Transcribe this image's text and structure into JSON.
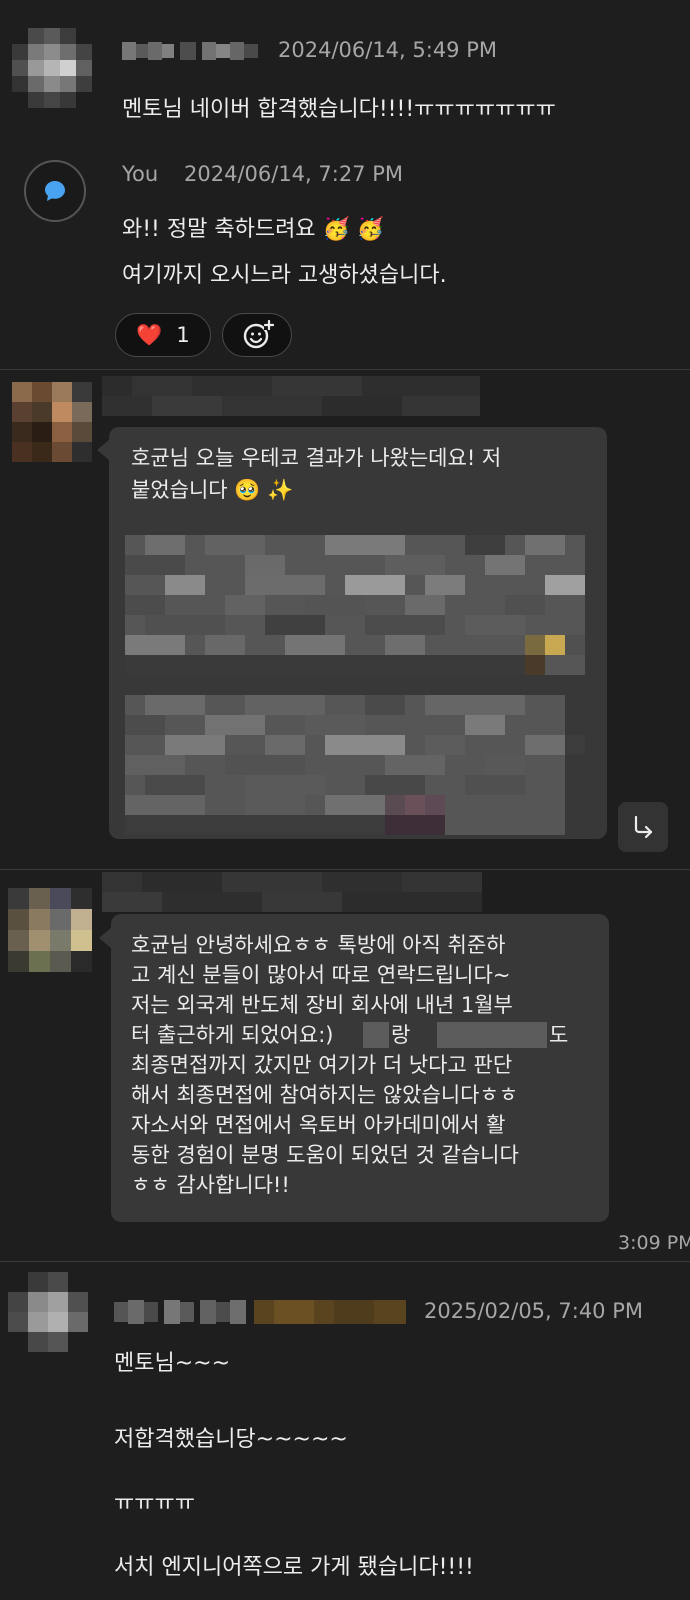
{
  "messages": [
    {
      "timestamp": "2024/06/14, 5:49 PM",
      "text": "멘토님 네이버 합격했습니다!!!!ㅠㅠㅠㅠㅠㅠㅠ"
    },
    {
      "sender": "You",
      "timestamp": "2024/06/14, 7:27 PM",
      "lines": [
        "와!! 정말 축하드려요 🥳 🥳",
        "여기까지 오시느라 고생하셨습니다."
      ],
      "reaction": {
        "emoji": "❤️",
        "count": "1"
      }
    },
    {
      "lines": [
        "호균님 오늘 우테코 결과가 나왔는데요! 저",
        "붙었습니다 🥹 ✨"
      ]
    },
    {
      "lines": [
        "호균님 안녕하세요ㅎㅎ 톡방에 아직 취준하",
        "고 계신 분들이 많아서 따로 연락드립니다~",
        "저는 외국계 반도체 장비 회사에 내년 1월부",
        "터 출근하게 되었어요:)",
        "랑",
        "도",
        "최종면접까지 갔지만 여기가 더 낫다고 판단",
        "해서 최종면접에 참여하지는 않았습니다ㅎㅎ",
        "자소서와 면접에서 옥토버 아카데미에서 활",
        "동한 경험이 분명 도움이 되었던 것 같습니다",
        "ㅎㅎ 감사합니다!!"
      ],
      "time": "3:09 PM"
    },
    {
      "timestamp": "2025/02/05, 7:40 PM",
      "lines": [
        "멘토님~~~",
        "저합격했습니당~~~~~",
        "ㅠㅠㅠㅠ",
        "서치 엔지니어쪽으로 가게 됐습니다!!!!"
      ]
    }
  ],
  "icons": {
    "you_avatar": "chat-bubble-icon",
    "add_reaction": "smiley-plus-icon",
    "reply": "reply-arrow-icon"
  },
  "colors": {
    "background": "#1e1e1e",
    "bubble": "#383838",
    "accent_blue": "#4aa3f0"
  }
}
